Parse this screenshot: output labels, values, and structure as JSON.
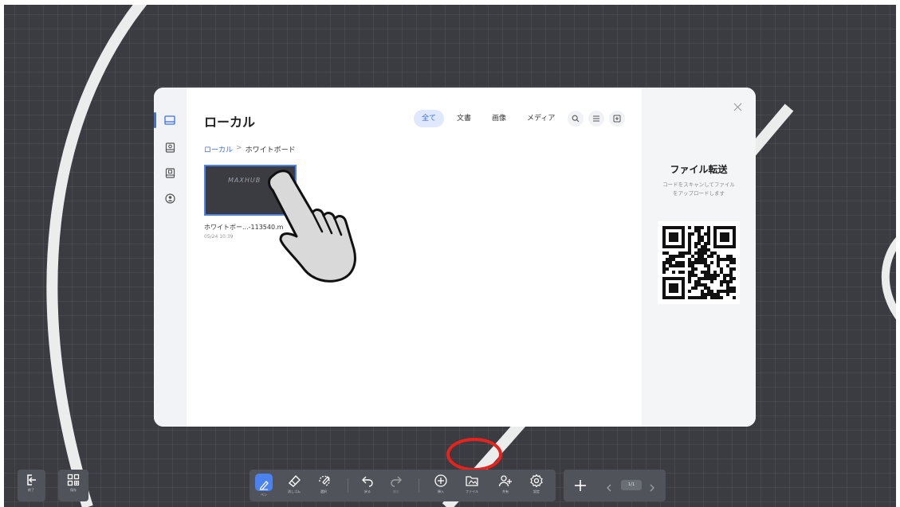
{
  "dialog": {
    "title": "ローカル",
    "filters": [
      {
        "label": "全て",
        "active": true
      },
      {
        "label": "文書",
        "active": false
      },
      {
        "label": "画像",
        "active": false
      },
      {
        "label": "メディア",
        "active": false
      }
    ],
    "breadcrumb": {
      "root": "ローカル",
      "separator": ">",
      "current": "ホワイトボード"
    },
    "file": {
      "name": "ホワイトボー...-113540.m",
      "date": "05/24 10:39",
      "thumbnail_text": "MAXHUB"
    },
    "side_rail_icons": [
      "local-storage-icon",
      "cloud-drive-icon",
      "usb-drive-icon",
      "account-icon"
    ],
    "toolbar_icons": [
      "search-icon",
      "list-view-icon",
      "import-icon"
    ],
    "transfer": {
      "title": "ファイル転送",
      "description_line1": "コードをスキャンしてファイル",
      "description_line2": "をアップロードします"
    }
  },
  "bottom_bar": {
    "left": [
      {
        "icon": "exit-icon",
        "label": "終了"
      },
      {
        "icon": "grid-icon",
        "label": "保存"
      }
    ],
    "tools": [
      {
        "icon": "pen-icon",
        "label": "ペン",
        "active": true
      },
      {
        "icon": "eraser-icon",
        "label": "消しゴム"
      },
      {
        "icon": "lasso-select-icon",
        "label": "選択"
      },
      {
        "icon": "undo-icon",
        "label": "戻る"
      },
      {
        "icon": "redo-icon",
        "label": "進む",
        "disabled": true
      },
      {
        "icon": "insert-icon",
        "label": "挿入"
      },
      {
        "icon": "file-icon",
        "label": "ファイル"
      },
      {
        "icon": "share-icon",
        "label": "共有"
      },
      {
        "icon": "settings-icon",
        "label": "設定"
      }
    ],
    "pages": {
      "indicator": "1/1"
    }
  },
  "colors": {
    "accent": "#3b6fe6",
    "board": "#3a3c41",
    "highlight": "#e8221c"
  }
}
